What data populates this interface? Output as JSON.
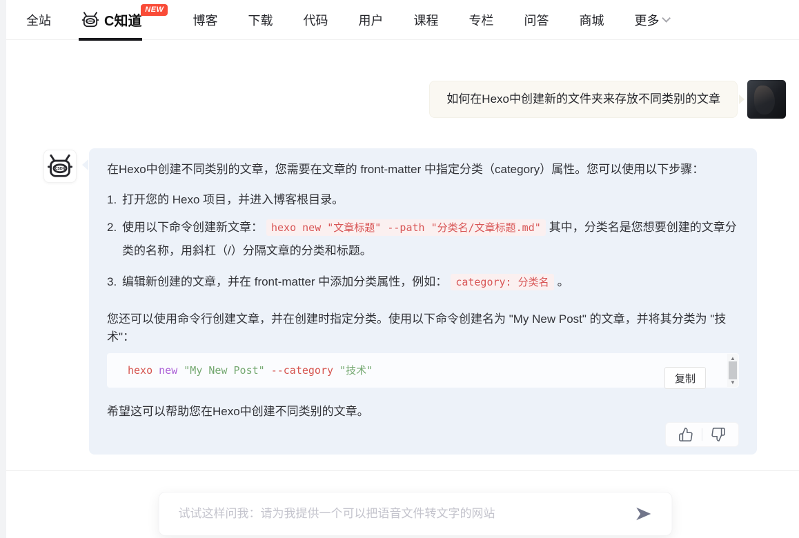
{
  "nav": {
    "items": [
      "全站",
      "C知道",
      "博客",
      "下载",
      "代码",
      "用户",
      "课程",
      "专栏",
      "问答",
      "商城",
      "更多"
    ],
    "badge": "NEW",
    "active_item": "C知道"
  },
  "chat": {
    "question": {
      "text": "如何在Hexo中创建新的文件夹来存放不同类别的文章"
    },
    "answer": {
      "intro": "在Hexo中创建不同类别的文章，您需要在文章的 front-matter 中指定分类（category）属性。您可以使用以下步骤：",
      "steps": [
        {
          "num": "1.",
          "before": "打开您的 Hexo 项目，并进入博客根目录。",
          "code": "",
          "after": ""
        },
        {
          "num": "2.",
          "before": "使用以下命令创建新文章：",
          "code": "hexo new \"文章标题\" --path \"分类名/文章标题.md\"",
          "after": "其中，分类名是您想要创建的文章分类的名称，用斜杠（/）分隔文章的分类和标题。"
        },
        {
          "num": "3.",
          "before": "编辑新创建的文章，并在 front-matter 中添加分类属性，例如：",
          "code": "category: 分类名",
          "after": "。"
        }
      ],
      "para2": "您还可以使用命令行创建文章，并在创建时指定分类。使用以下命令创建名为 \"My New Post\" 的文章，并将其分类为 \"技术\"：",
      "code_block": {
        "tokens": [
          "hexo ",
          "new ",
          "\"My New Post\" ",
          "--category ",
          "\"技术\""
        ],
        "copy_label": "复制"
      },
      "outro": "希望这可以帮助您在Hexo中创建不同类别的文章。"
    }
  },
  "composer": {
    "placeholder": "试试这样问我：请为我提供一个可以把语音文件转文字的网站"
  },
  "icons": {
    "robot": "csdn-robot-icon",
    "chevron": "chevron-down-icon",
    "thumbs_up": "thumbs-up-icon",
    "thumbs_down": "thumbs-down-icon",
    "send": "send-icon"
  },
  "colors": {
    "badge_red": "#f94b37",
    "answer_bubble": "#edf2f9",
    "question_bubble": "#faf8f2",
    "inline_code_text": "#d85555",
    "inline_code_bg": "#fbf0f0",
    "code_token_red": "#d6544e",
    "code_token_purple": "#ab5fd6",
    "code_token_green": "#74a870",
    "active_underline": "#18181c"
  }
}
